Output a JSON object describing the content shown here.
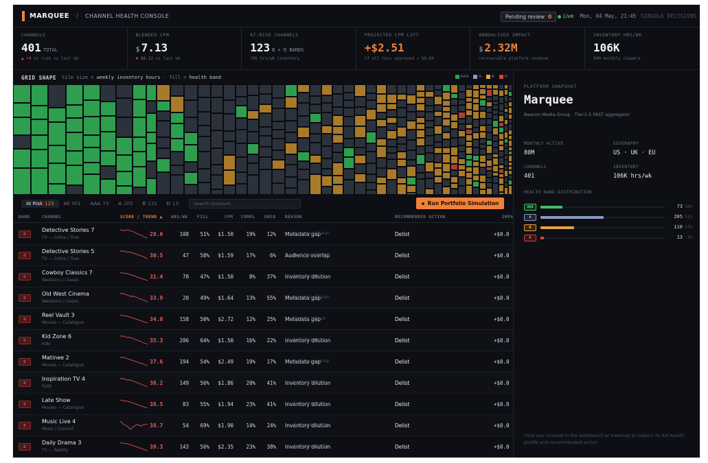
{
  "topbar": {
    "brand": "MARQUEE",
    "sep": "/",
    "title": "CHANNEL HEALTH CONSOLE",
    "pending_label": "Pending review",
    "pending_count": "0",
    "live": "Live",
    "clock": "Mon, 04 May, 21:45",
    "company": "SINGULA DECISIONS",
    "accent": "#f0813a"
  },
  "kpis": [
    {
      "label": "CHANNELS",
      "value": "401",
      "unit": "TOTAL",
      "sub_a": "▲ +4",
      "sub_b": "at risk vs last wk"
    },
    {
      "label": "BLENDED CPM",
      "prefix": "$",
      "value": "7.13",
      "sub_a": "▼ $0.12",
      "sub_b": "vs last wk"
    },
    {
      "label": "AT-RISK CHANNELS",
      "value": "123",
      "unit": "B + D BANDS",
      "sub": "19K hrs/wk inventory"
    },
    {
      "label": "PROJECTED CPM LIFT",
      "value": "+$2.51",
      "sub": "if all recs approved → $9.64"
    },
    {
      "label": "ANNUALISED IMPACT",
      "prefix": "$",
      "value": "2.32M",
      "sub": "recoverable platform revenue"
    },
    {
      "label": "INVENTORY HRS/WK",
      "value": "106K",
      "sub": "80M monthly viewers"
    }
  ],
  "grid": {
    "title": "GRID SHAPE",
    "desc_1": "tile size =",
    "desc_2": "weekly inventory hours",
    "desc_3": "· fill =",
    "desc_4": "health band",
    "legend": [
      {
        "name": "AAA",
        "color": "#2e9e4f"
      },
      {
        "name": "A",
        "color": "#8a9bc0"
      },
      {
        "name": "B",
        "color": "#e6a23c"
      },
      {
        "name": "D",
        "color": "#d9453d"
      }
    ]
  },
  "filters": {
    "tabs": [
      {
        "label": "At Risk",
        "count": "123"
      },
      {
        "label": "All",
        "count": "401"
      },
      {
        "label": "AAA",
        "count": "73"
      },
      {
        "label": "A",
        "count": "205"
      },
      {
        "label": "B",
        "count": "110"
      },
      {
        "label": "D",
        "count": "13"
      }
    ],
    "search_placeholder": "Search channels...",
    "run_label": "Run Portfolio Simulation"
  },
  "table": {
    "headers": {
      "band": "BAND",
      "channel": "CHANNEL",
      "score": "SCORE / TREND ▲",
      "hrs": "HRS/WK",
      "fill": "FILL",
      "cpm": "CPM",
      "compl": "COMPL",
      "uniq": "UNIQ",
      "reason": "REASON",
      "action": "RECOMMENDED ACTION",
      "impact": "IMPA"
    },
    "rows": [
      {
        "band": "D",
        "name": "Detective Stories 7",
        "genre": "TV — Crime / True",
        "score": "28.6",
        "hrs": "108",
        "fill": "51%",
        "cpm": "$1.50",
        "compl": "19%",
        "uniq": "12%",
        "reason": "Metadata gap",
        "reason2": "+ Inventory dilution",
        "action": "Delist",
        "impact": "+$0.0",
        "trend": [
          10,
          9,
          10,
          9,
          8,
          6,
          5,
          3,
          2
        ]
      },
      {
        "band": "D",
        "name": "Detective Stories 5",
        "genre": "TV — Crime / True",
        "score": "30.5",
        "hrs": "47",
        "fill": "58%",
        "cpm": "$1.59",
        "compl": "17%",
        "uniq": "6%",
        "reason": "Audience overlap",
        "reason2": "+ Inventory dilution",
        "action": "Delist",
        "impact": "+$0.0",
        "trend": [
          9,
          9,
          8,
          8,
          7,
          6,
          5,
          4,
          2
        ]
      },
      {
        "band": "D",
        "name": "Cowboy Classics 7",
        "genre": "Westerns / Classic",
        "score": "31.4",
        "hrs": "78",
        "fill": "47%",
        "cpm": "$1.50",
        "compl": "8%",
        "uniq": "37%",
        "reason": "Inventory dilution",
        "reason2": "+ Metadata gap",
        "action": "Delist",
        "impact": "+$0.0",
        "trend": [
          10,
          9,
          9,
          8,
          7,
          6,
          5,
          4,
          3
        ]
      },
      {
        "band": "D",
        "name": "Old West Cinema",
        "genre": "Westerns / Classic",
        "score": "33.9",
        "hrs": "20",
        "fill": "49%",
        "cpm": "$1.64",
        "compl": "13%",
        "uniq": "55%",
        "reason": "Metadata gap",
        "reason2": "+ Inventory dilution",
        "action": "Delist",
        "impact": "+$0.0",
        "trend": [
          9,
          9,
          8,
          7,
          7,
          6,
          5,
          4,
          3
        ]
      },
      {
        "band": "D",
        "name": "Reel Vault 3",
        "genre": "Movies — Catalogue",
        "score": "34.0",
        "hrs": "158",
        "fill": "50%",
        "cpm": "$2.72",
        "compl": "12%",
        "uniq": "25%",
        "reason": "Metadata gap",
        "reason2": "+ Content fatigue",
        "action": "Delist",
        "impact": "+$0.0",
        "trend": [
          10,
          9,
          9,
          8,
          7,
          6,
          5,
          4,
          3
        ]
      },
      {
        "band": "D",
        "name": "Kid Zone 6",
        "genre": "Kids",
        "score": "35.3",
        "hrs": "206",
        "fill": "64%",
        "cpm": "$1.50",
        "compl": "16%",
        "uniq": "22%",
        "reason": "Inventory dilution",
        "reason2": "+ Metadata gap",
        "action": "Delist",
        "impact": "+$0.0",
        "trend": [
          9,
          9,
          8,
          8,
          7,
          6,
          5,
          4,
          3
        ]
      },
      {
        "band": "D",
        "name": "Matinee 2",
        "genre": "Movies — Catalogue",
        "score": "37.6",
        "hrs": "194",
        "fill": "54%",
        "cpm": "$2.49",
        "compl": "19%",
        "uniq": "17%",
        "reason": "Metadata gap",
        "reason2": "+ Audience overlap",
        "action": "Delist",
        "impact": "+$0.0",
        "trend": [
          10,
          10,
          9,
          8,
          7,
          6,
          5,
          4,
          3
        ]
      },
      {
        "band": "D",
        "name": "Inspiration TV 4",
        "genre": "Faith",
        "score": "38.2",
        "hrs": "149",
        "fill": "56%",
        "cpm": "$1.86",
        "compl": "20%",
        "uniq": "41%",
        "reason": "Inventory dilution",
        "reason2": "+ Content fatigue",
        "action": "Delist",
        "impact": "+$0.0",
        "trend": [
          9,
          9,
          8,
          8,
          7,
          6,
          5,
          4,
          3
        ]
      },
      {
        "band": "D",
        "name": "Late Show",
        "genre": "Movies — Catalogue",
        "score": "38.5",
        "hrs": "83",
        "fill": "55%",
        "cpm": "$1.94",
        "compl": "23%",
        "uniq": "41%",
        "reason": "Inventory dilution",
        "reason2": "+ Content fatigue",
        "action": "Delist",
        "impact": "+$0.0",
        "trend": [
          10,
          9,
          9,
          8,
          7,
          6,
          5,
          4,
          3
        ]
      },
      {
        "band": "D",
        "name": "Music Live 4",
        "genre": "Music / Concert",
        "score": "38.7",
        "hrs": "54",
        "fill": "69%",
        "cpm": "$1.90",
        "compl": "14%",
        "uniq": "24%",
        "reason": "Inventory dilution",
        "reason2": "+ Audience overlap",
        "action": "Delist",
        "impact": "+$0.0",
        "trend": [
          8,
          6,
          5,
          3,
          5,
          6,
          5,
          6,
          6
        ]
      },
      {
        "band": "D",
        "name": "Daily Drama 3",
        "genre": "TV — Reality",
        "score": "39.3",
        "hrs": "143",
        "fill": "56%",
        "cpm": "$2.35",
        "compl": "23%",
        "uniq": "38%",
        "reason": "Inventory dilution",
        "reason2": "+ Audience overlap",
        "action": "Delist",
        "impact": "+$0.0",
        "trend": [
          10,
          9,
          9,
          8,
          7,
          6,
          5,
          4,
          3
        ]
      }
    ]
  },
  "panel": {
    "label": "PLATFORM SNAPSHOT",
    "name": "Marquee",
    "sub": "Beacon Media Group · Tier-1.5 FAST aggregator",
    "fields": [
      {
        "label": "MONTHLY ACTIVE",
        "value": "80M"
      },
      {
        "label": "GEOGRAPHY",
        "value": "US · UK · EU"
      },
      {
        "label": "CHANNELS",
        "value": "401"
      },
      {
        "label": "INVENTORY",
        "value": "106K hrs/wk"
      }
    ],
    "dist_label": "HEALTH BAND DISTRIBUTION",
    "dist": [
      {
        "band": "AAA",
        "count": "73",
        "pct": "18%",
        "share": 0.18,
        "color": "#3fbf6a",
        "tagbg": "#12301c",
        "tagfg": "#6fd38f"
      },
      {
        "band": "A",
        "count": "205",
        "pct": "51%",
        "share": 0.51,
        "color": "#8a9bc0",
        "tagbg": "#1e2533",
        "tagfg": "#a9b7d6"
      },
      {
        "band": "B",
        "count": "110",
        "pct": "27%",
        "share": 0.27,
        "color": "#e6a23c",
        "tagbg": "#35260d",
        "tagfg": "#f0b860"
      },
      {
        "band": "D",
        "count": "13",
        "pct": "3%",
        "share": 0.03,
        "color": "#d9453d",
        "tagbg": "#3a1414",
        "tagfg": "#f07a70"
      }
    ],
    "hint": "Click any channel in the workbench or treemap to inspect its full health profile and recommended action."
  }
}
